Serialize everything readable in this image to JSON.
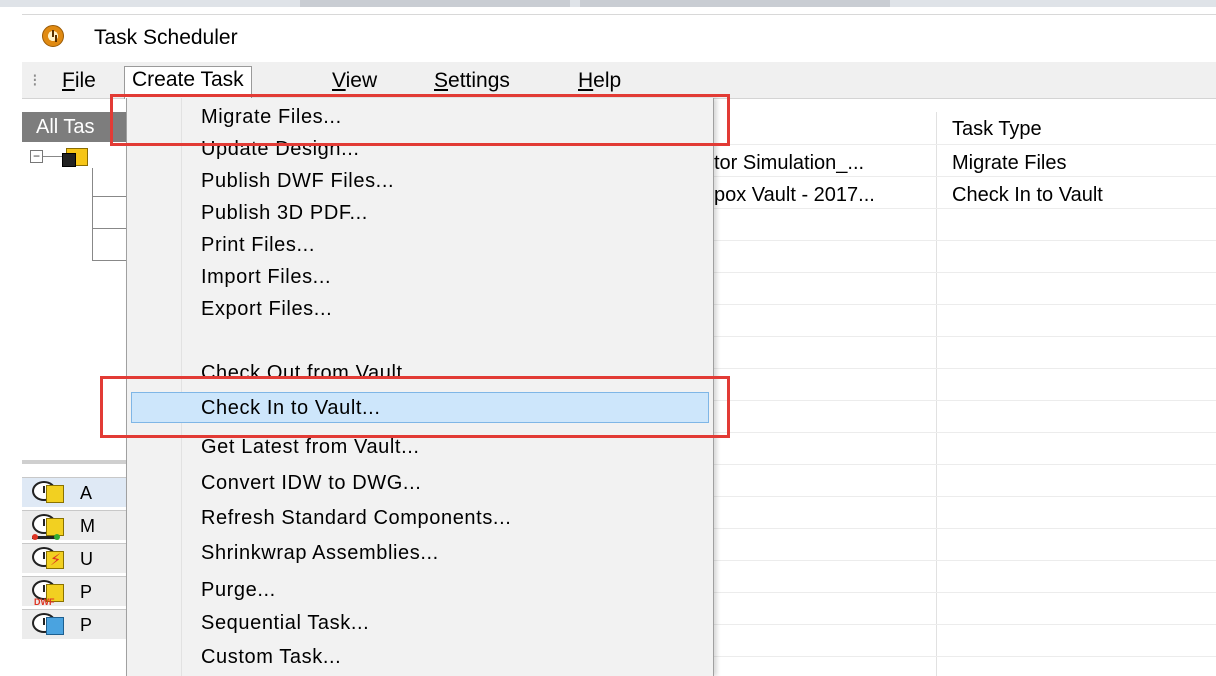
{
  "window": {
    "title": "Task Scheduler",
    "icon": "clock-icon"
  },
  "menubar": {
    "items": [
      {
        "label": "File",
        "mnemonic_index": 0
      },
      {
        "label": "Create Task",
        "mnemonic_index": 0,
        "open": true
      },
      {
        "label": "View",
        "mnemonic_index": 0
      },
      {
        "label": "Settings",
        "mnemonic_index": 0
      },
      {
        "label": "Help",
        "mnemonic_index": 0
      }
    ]
  },
  "left_panel": {
    "header": "All Tas",
    "tree_root_icon": "folder-tasks-icon",
    "buttons": [
      {
        "letter": "A",
        "icon": "all-tasks-icon"
      },
      {
        "letter": "M",
        "icon": "migrate-files-icon"
      },
      {
        "letter": "U",
        "icon": "update-design-icon"
      },
      {
        "letter": "P",
        "icon": "publish-dwf-icon",
        "badge": "DWF"
      },
      {
        "letter": "P",
        "icon": "publish-3d-pdf-icon"
      }
    ]
  },
  "grid": {
    "columns": [
      "Task Type"
    ],
    "rows": [
      {
        "name": "tor Simulation_...",
        "type": "Migrate Files"
      },
      {
        "name": "pox Vault - 2017...",
        "type": "Check In to Vault"
      }
    ]
  },
  "dropdown": {
    "items": [
      {
        "label": "Migrate Files...",
        "boxed": true
      },
      {
        "label": "Update Design..."
      },
      {
        "label": "Publish DWF Files..."
      },
      {
        "label": "Publish 3D PDF..."
      },
      {
        "label": "Print Files..."
      },
      {
        "label": "Import Files..."
      },
      {
        "label": "Export Files..."
      },
      {
        "label": "Check Out from Vault..."
      },
      {
        "label": "Check In to Vault...",
        "highlighted": true,
        "boxed": true
      },
      {
        "label": "Get Latest from Vault..."
      },
      {
        "label": "Convert IDW to DWG..."
      },
      {
        "label": "Refresh Standard Components..."
      },
      {
        "label": "Shrinkwrap Assemblies..."
      },
      {
        "label": "Purge..."
      },
      {
        "label": "Sequential Task..."
      },
      {
        "label": "Custom Task..."
      }
    ]
  },
  "colors": {
    "highlight_fill": "#cde6fb",
    "highlight_border": "#7fb6e6",
    "annotation_red": "#e23b35",
    "panel_header": "#7d7d7d"
  }
}
